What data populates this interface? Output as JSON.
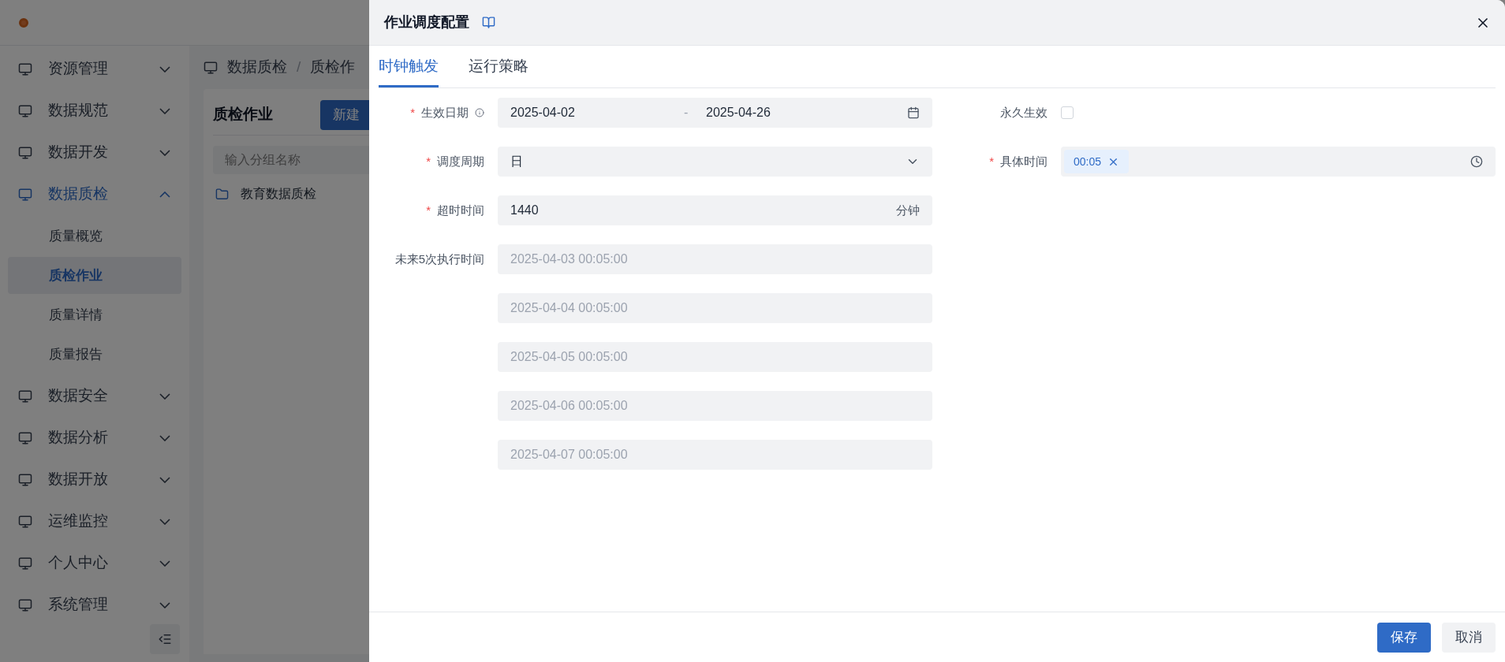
{
  "sidebar": {
    "items": [
      {
        "label": "资源管理",
        "expanded": false,
        "selected": false
      },
      {
        "label": "数据规范",
        "expanded": false,
        "selected": false
      },
      {
        "label": "数据开发",
        "expanded": false,
        "selected": false
      },
      {
        "label": "数据质检",
        "expanded": true,
        "selected": true,
        "children": [
          {
            "label": "质量概览",
            "selected": false
          },
          {
            "label": "质检作业",
            "selected": true
          },
          {
            "label": "质量详情",
            "selected": false
          },
          {
            "label": "质量报告",
            "selected": false
          }
        ]
      },
      {
        "label": "数据安全",
        "expanded": false,
        "selected": false
      },
      {
        "label": "数据分析",
        "expanded": false,
        "selected": false
      },
      {
        "label": "数据开放",
        "expanded": false,
        "selected": false
      },
      {
        "label": "运维监控",
        "expanded": false,
        "selected": false
      },
      {
        "label": "个人中心",
        "expanded": false,
        "selected": false
      },
      {
        "label": "系统管理",
        "expanded": false,
        "selected": false
      }
    ]
  },
  "breadcrumb": [
    "数据质检",
    "质检作"
  ],
  "breadcrumb_separator": "/",
  "panel": {
    "title": "质检作业",
    "new_button": "新建",
    "search": {
      "placeholder": "输入分组名称"
    },
    "tree": [
      "教育数据质检"
    ]
  },
  "drawer": {
    "title": "作业调度配置",
    "tabs": [
      {
        "label": "时钟触发",
        "selected": true
      },
      {
        "label": "运行策略",
        "selected": false
      }
    ],
    "left_fields": [
      {
        "kind": "daterange",
        "label": "生效日期",
        "required_mark": "*",
        "start": "2025-04-02",
        "separator": "-",
        "end": "2025-04-26"
      },
      {
        "kind": "select",
        "label": "调度周期",
        "required_mark": "*",
        "value": "日"
      },
      {
        "kind": "number",
        "label": "超时时间",
        "required_mark": "*",
        "value": "1440",
        "suffix": "分钟"
      },
      {
        "kind": "list",
        "label": "未来5次执行时间",
        "values": [
          "2025-04-03 00:05:00",
          "2025-04-04 00:05:00",
          "2025-04-05 00:05:00",
          "2025-04-06 00:05:00",
          "2025-04-07 00:05:00"
        ]
      }
    ],
    "right_fields": [
      {
        "kind": "checkbox",
        "label": "永久生效",
        "checked": false
      },
      {
        "kind": "tags",
        "label": "具体时间",
        "required_mark": "*",
        "tags": [
          "00:05"
        ]
      }
    ],
    "buttons": [
      {
        "label": "保存",
        "kind": "primary"
      },
      {
        "label": "取消",
        "kind": "secondary"
      }
    ]
  }
}
